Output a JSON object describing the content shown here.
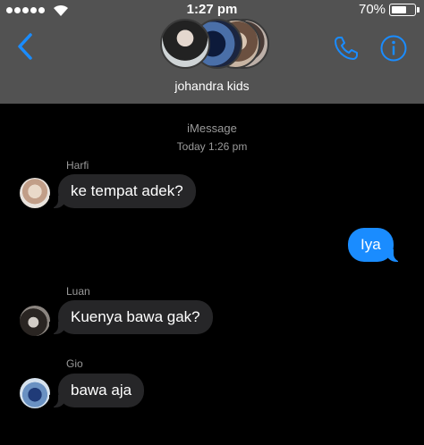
{
  "status_bar": {
    "signal_dots": 5,
    "time": "1:27 pm",
    "battery_percent": "70%",
    "battery_level": 0.7,
    "wifi_icon": "wifi-icon",
    "battery_icon": "battery-icon"
  },
  "header": {
    "group_name": "johandra kids",
    "back_icon": "chevron-left-icon",
    "call_icon": "phone-icon",
    "info_icon": "info-icon",
    "accent_color": "#1a8cff",
    "background_color": "#525252"
  },
  "conversation": {
    "service": "iMessage",
    "timestamp": "Today 1:26 pm",
    "messages": [
      {
        "sender": "Harfi",
        "text": "ke tempat adek?",
        "direction": "incoming"
      },
      {
        "sender": "",
        "text": "Iya",
        "direction": "outgoing"
      },
      {
        "sender": "Luan",
        "text": "Kuenya bawa gak?",
        "direction": "incoming"
      },
      {
        "sender": "Gio",
        "text": "bawa aja",
        "direction": "incoming"
      }
    ],
    "incoming_bubble_color": "#262628",
    "outgoing_bubble_color": "#1a8cff"
  }
}
